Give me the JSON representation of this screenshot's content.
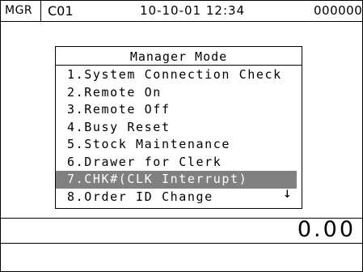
{
  "status_bar": {
    "mode": "MGR",
    "clerk": "C01",
    "datetime": "10-10-01 12:34",
    "counter": "000000"
  },
  "menu": {
    "title": "Manager Mode",
    "items": [
      {
        "label": "1.System Connection Check",
        "selected": false
      },
      {
        "label": "2.Remote On",
        "selected": false
      },
      {
        "label": "3.Remote Off",
        "selected": false
      },
      {
        "label": "4.Busy Reset",
        "selected": false
      },
      {
        "label": "5.Stock Maintenance",
        "selected": false
      },
      {
        "label": "6.Drawer for Clerk",
        "selected": false
      },
      {
        "label": "7.CHK#(CLK Interrupt)",
        "selected": true
      },
      {
        "label": "8.Order ID Change",
        "selected": false
      }
    ],
    "scroll_indicator": "↓",
    "scroll_icon": "down-arrow-icon",
    "highlight_color": "#808080"
  },
  "amount": "0.00"
}
